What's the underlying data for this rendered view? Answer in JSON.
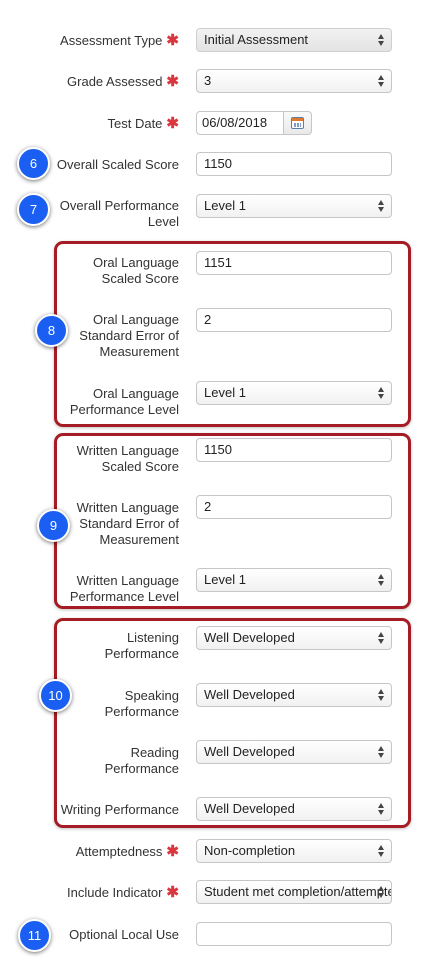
{
  "form": {
    "assessment_type": {
      "label": "Assessment Type",
      "required": "✱",
      "value": "Initial Assessment"
    },
    "grade_assessed": {
      "label": "Grade Assessed",
      "required": "✱",
      "value": "3"
    },
    "test_date": {
      "label": "Test Date",
      "required": "✱",
      "value": "06/08/2018",
      "button_icon": "calendar-icon"
    },
    "overall_scaled_score": {
      "label": "Overall Scaled Score",
      "value": "1150"
    },
    "overall_performance_level": {
      "label_line1": "Overall Performance",
      "label_line2": "Level",
      "value": "Level 1"
    },
    "oral_language_scaled_score": {
      "label_line1": "Oral Language",
      "label_line2": "Scaled Score",
      "value": "1151"
    },
    "oral_language_sem": {
      "label_line1": "Oral Language",
      "label_line2": "Standard Error of",
      "label_line3": "Measurement",
      "value": "2"
    },
    "oral_language_performance_level": {
      "label_line1": "Oral Language",
      "label_line2": "Performance Level",
      "value": "Level 1"
    },
    "written_language_scaled_score": {
      "label_line1": "Written Language",
      "label_line2": "Scaled Score",
      "value": "1150"
    },
    "written_language_sem": {
      "label_line1": "Written Language",
      "label_line2": "Standard Error of",
      "label_line3": "Measurement",
      "value": "2"
    },
    "written_language_performance_level": {
      "label_line1": "Written Language",
      "label_line2": "Performance Level",
      "value": "Level 1"
    },
    "listening_performance": {
      "label_line1": "Listening",
      "label_line2": "Performance",
      "value": "Well Developed"
    },
    "speaking_performance": {
      "label_line1": "Speaking",
      "label_line2": "Performance",
      "value": "Well Developed"
    },
    "reading_performance": {
      "label_line1": "Reading",
      "label_line2": "Performance",
      "value": "Well Developed"
    },
    "writing_performance": {
      "label": "Writing Performance",
      "value": "Well Developed"
    },
    "attemptedness": {
      "label": "Attemptedness",
      "required": "✱",
      "value": "Non-completion"
    },
    "include_indicator": {
      "label": "Include Indicator",
      "required": "✱",
      "value": "Student met completion/attemptedness"
    },
    "optional_local_use": {
      "label": "Optional Local Use",
      "value": ""
    }
  },
  "badges": {
    "b6": "6",
    "b7": "7",
    "b8": "8",
    "b9": "9",
    "b10": "10",
    "b11": "11"
  },
  "colors": {
    "badge": "#1a5ff2",
    "group_border": "#a51c24",
    "required": "#d9363e"
  }
}
